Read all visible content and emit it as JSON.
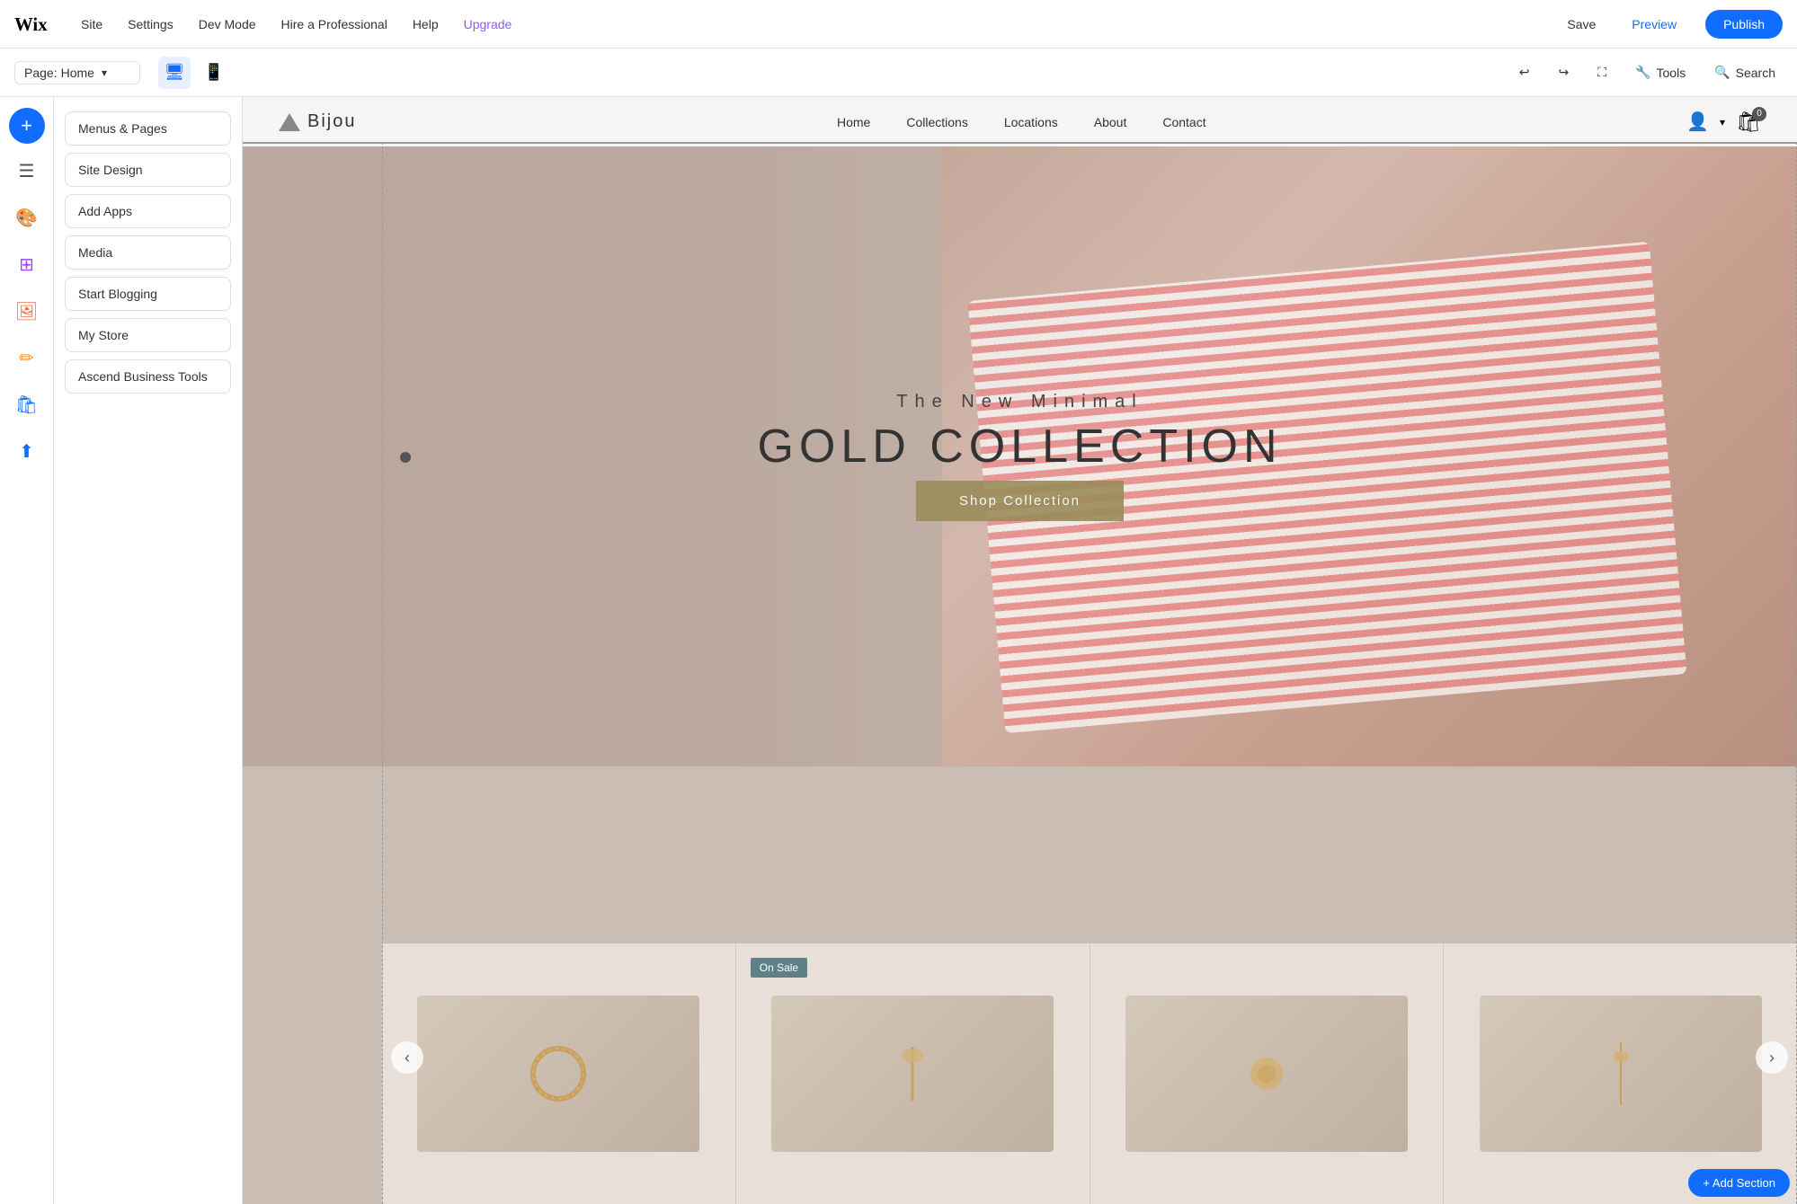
{
  "topNav": {
    "wixLogoAlt": "Wix",
    "navItems": [
      {
        "label": "Site",
        "id": "site"
      },
      {
        "label": "Settings",
        "id": "settings"
      },
      {
        "label": "Dev Mode",
        "id": "dev-mode"
      },
      {
        "label": "Hire a Professional",
        "id": "hire"
      },
      {
        "label": "Help",
        "id": "help"
      },
      {
        "label": "Upgrade",
        "id": "upgrade"
      }
    ],
    "saveLabel": "Save",
    "previewLabel": "Preview",
    "publishLabel": "Publish"
  },
  "secondaryNav": {
    "pageLabel": "Page:",
    "pageName": "Home",
    "desktopIcon": "🖥",
    "mobileIcon": "📱",
    "toolsLabel": "Tools",
    "searchLabel": "Search",
    "undoIcon": "↩",
    "redoIcon": "↪"
  },
  "leftSidebar": {
    "addIcon": "+",
    "icons": [
      {
        "id": "pages",
        "symbol": "☰",
        "label": "Pages"
      },
      {
        "id": "design",
        "symbol": "🎨",
        "label": "Design"
      },
      {
        "id": "apps",
        "symbol": "⊞",
        "label": "Apps"
      },
      {
        "id": "media",
        "symbol": "🖼",
        "label": "Media"
      },
      {
        "id": "blog",
        "symbol": "✍",
        "label": "Blog"
      },
      {
        "id": "store",
        "symbol": "🛍",
        "label": "Store"
      },
      {
        "id": "ascend",
        "symbol": "⬆",
        "label": "Ascend"
      }
    ]
  },
  "panel": {
    "buttons": [
      {
        "id": "menus-pages",
        "label": "Menus & Pages"
      },
      {
        "id": "site-design",
        "label": "Site Design"
      },
      {
        "id": "add-apps",
        "label": "Add Apps"
      },
      {
        "id": "media",
        "label": "Media"
      },
      {
        "id": "start-blogging",
        "label": "Start Blogging"
      },
      {
        "id": "my-store",
        "label": "My Store"
      },
      {
        "id": "ascend-business-tools",
        "label": "Ascend Business Tools"
      }
    ]
  },
  "siteNav": {
    "logoText": "Bijou",
    "navItems": [
      {
        "label": "Home",
        "active": true
      },
      {
        "label": "Collections"
      },
      {
        "label": "Locations"
      },
      {
        "label": "About"
      },
      {
        "label": "Contact"
      }
    ],
    "cartCount": "0"
  },
  "hero": {
    "subtitle": "The New Minimal",
    "title": "GOLD COLLECTION",
    "ctaLabel": "Shop Collection"
  },
  "products": {
    "onSaleLabel": "On Sale",
    "prevArrow": "‹",
    "nextArrow": "›"
  },
  "colors": {
    "accent": "#116dff",
    "upgrade": "#8b5cf6",
    "publish": "#116dff",
    "heroCta": "#9a8c5a",
    "onSaleBadge": "rgba(70,110,120,0.85)"
  }
}
